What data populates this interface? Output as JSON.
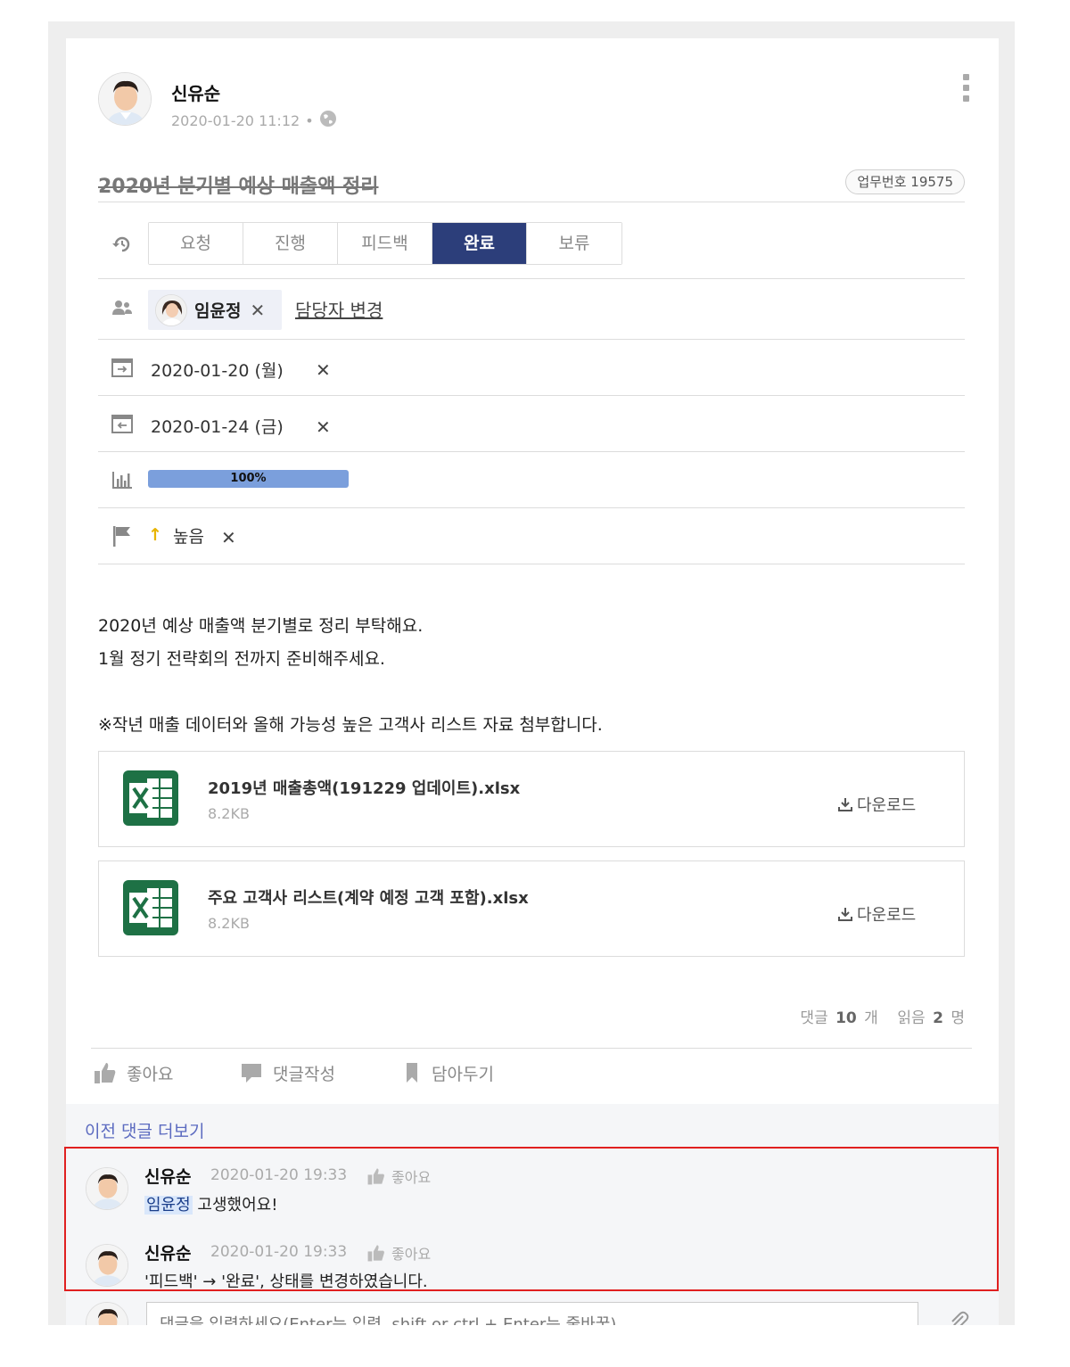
{
  "post": {
    "author": "신유순",
    "datetime": "2020-01-20 11:12",
    "separator": "•"
  },
  "task": {
    "title": "2020년 분기별 예상 매출액 정리",
    "number_label": "업무번호 19575",
    "statuses": [
      "요청",
      "진행",
      "피드백",
      "완료",
      "보류"
    ],
    "active_status": "완료",
    "assignee": "임윤정",
    "change_assignee": "담당자 변경",
    "start_date": "2020-01-20 (월)",
    "end_date": "2020-01-24 (금)",
    "progress_label": "100%",
    "progress_value": 100,
    "priority_arrow": "↑",
    "priority": "높음",
    "remove_symbol": "✕"
  },
  "body": {
    "lines": [
      "2020년 예상 매출액 분기별로 정리 부탁해요.",
      "1월 정기 전략회의 전까지 준비해주세요.",
      "",
      "※작년 매출 데이터와 올해 가능성 높은 고객사 리스트 자료 첨부합니다."
    ]
  },
  "attachments": [
    {
      "name": "2019년 매출총액(191229 업데이트).xlsx",
      "size": "8.2KB",
      "download": "다운로드"
    },
    {
      "name": "주요 고객사 리스트(계약 예정 고객 포함).xlsx",
      "size": "8.2KB",
      "download": "다운로드"
    }
  ],
  "stats": {
    "comments_label": "댓글",
    "comments_count": "10",
    "comments_unit": "개",
    "reads_label": "읽음",
    "reads_count": "2",
    "reads_unit": "명"
  },
  "actions": {
    "like": "좋아요",
    "comment": "댓글작성",
    "bookmark": "담아두기"
  },
  "comments": {
    "more": "이전 댓글 더보기",
    "items": [
      {
        "author": "신유순",
        "time": "2020-01-20 19:33",
        "like": "좋아요",
        "mention": "임윤정",
        "text": " 고생했어요!"
      },
      {
        "author": "신유순",
        "time": "2020-01-20 19:33",
        "like": "좋아요",
        "mention": "",
        "text": "'피드백' → '완료', 상태를 변경하였습니다."
      }
    ],
    "input_placeholder": "댓글을 입력하세요(Enter는 입력, shift or ctrl + Enter는 줄바꿈)"
  },
  "colors": {
    "active_tab": "#2c3e7a",
    "progress": "#7b9fdc",
    "link": "#5c6bc0",
    "highlight": "#e02020",
    "excel": "#1e7145"
  }
}
